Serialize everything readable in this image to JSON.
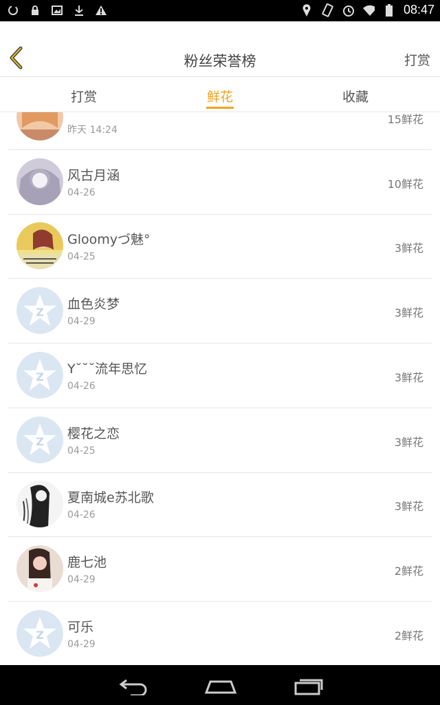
{
  "status": {
    "time": "08:47"
  },
  "header": {
    "title": "粉丝荣誉榜",
    "right_label": "打赏"
  },
  "tabs": [
    {
      "label": "打赏",
      "active": false
    },
    {
      "label": "鲜花",
      "active": true
    },
    {
      "label": "收藏",
      "active": false
    }
  ],
  "rows": [
    {
      "name": "",
      "date": "昨天 14:24",
      "count": "15鲜花",
      "avatar": "girl-warm"
    },
    {
      "name": "风古月涵",
      "date": "04-26",
      "count": "10鲜花",
      "avatar": "girl-pale"
    },
    {
      "name": "Gloomyづ魅°",
      "date": "04-25",
      "count": "3鲜花",
      "avatar": "girl-yellow"
    },
    {
      "name": "血色炎梦",
      "date": "04-29",
      "count": "3鲜花",
      "avatar": "default"
    },
    {
      "name": "Y˘˘˘流年思忆",
      "date": "04-26",
      "count": "3鲜花",
      "avatar": "default"
    },
    {
      "name": "樱花之恋",
      "date": "04-25",
      "count": "3鲜花",
      "avatar": "default"
    },
    {
      "name": "夏南城e苏北歌",
      "date": "04-26",
      "count": "3鲜花",
      "avatar": "sketch"
    },
    {
      "name": "鹿七池",
      "date": "04-29",
      "count": "2鲜花",
      "avatar": "girl-photo"
    },
    {
      "name": "可乐",
      "date": "04-29",
      "count": "2鲜花",
      "avatar": "default"
    }
  ],
  "colors": {
    "accent": "#f3a21d",
    "default_avatar": "#dbe6f3"
  }
}
